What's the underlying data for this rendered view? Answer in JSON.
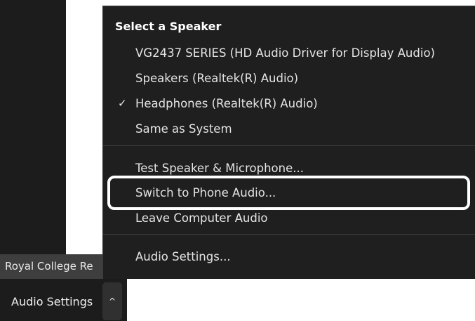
{
  "participant": {
    "name": "Royal College Re"
  },
  "speaker_menu": {
    "heading": "Select a Speaker",
    "speakers": [
      {
        "label": "VG2437 SERIES (HD Audio Driver for Display Audio)",
        "selected": false
      },
      {
        "label": "Speakers (Realtek(R) Audio)",
        "selected": false
      },
      {
        "label": "Headphones (Realtek(R) Audio)",
        "selected": true
      },
      {
        "label": "Same as System",
        "selected": false
      }
    ],
    "check_glyph": "✓",
    "actions": {
      "test": "Test Speaker & Microphone...",
      "switch_phone": "Switch to Phone Audio...",
      "leave": "Leave Computer Audio"
    },
    "settings": "Audio Settings..."
  },
  "toolbar": {
    "audio_settings_label": "Audio Settings",
    "caret_glyph": "^",
    "caret_icon": "chevron-up-icon"
  },
  "colors": {
    "menu_bg": "#1f1f1f",
    "toolbar_bg": "#1c1c1c",
    "highlight_border": "#ffffff"
  }
}
